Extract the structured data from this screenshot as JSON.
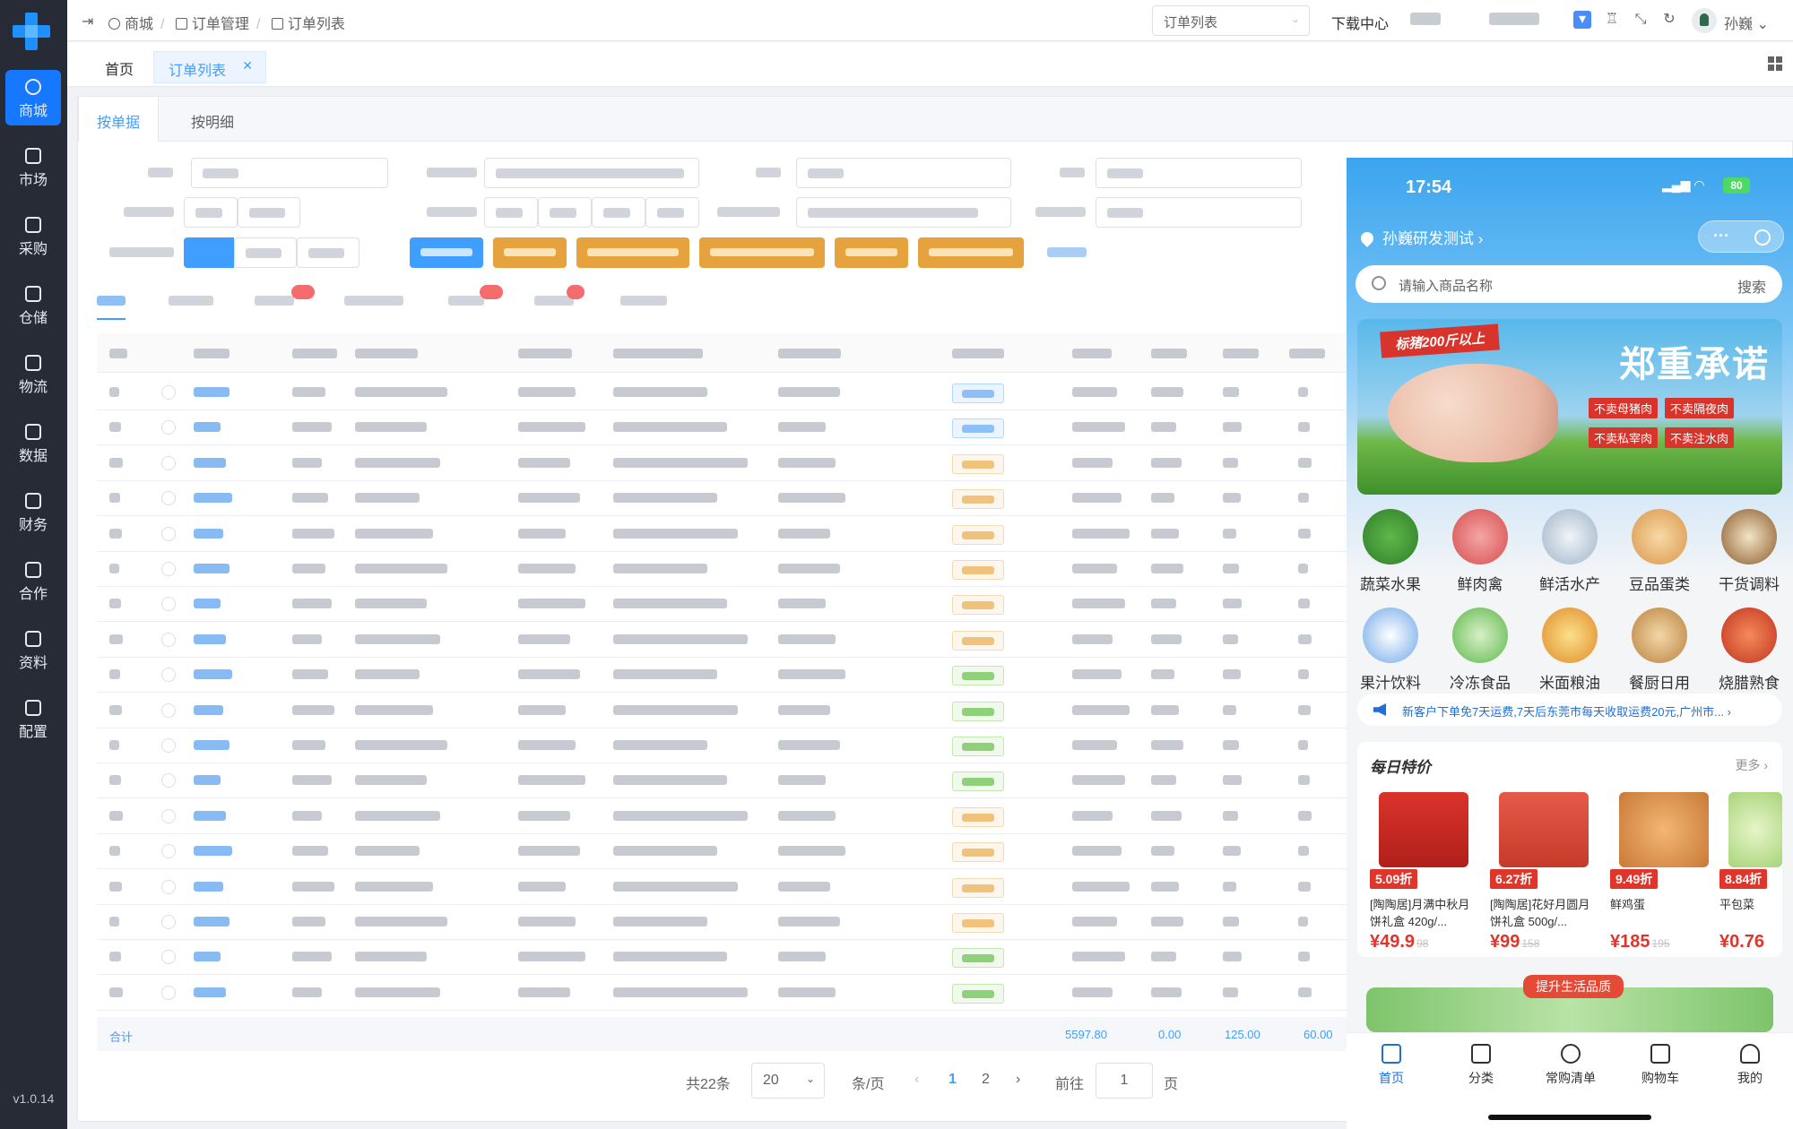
{
  "sidebar": {
    "items": [
      {
        "label": "商城",
        "icon": "shop-icon",
        "active": true
      },
      {
        "label": "市场",
        "icon": "market-icon"
      },
      {
        "label": "采购",
        "icon": "purchase-icon"
      },
      {
        "label": "仓储",
        "icon": "warehouse-icon"
      },
      {
        "label": "物流",
        "icon": "truck-icon"
      },
      {
        "label": "数据",
        "icon": "database-icon"
      },
      {
        "label": "财务",
        "icon": "finance-icon"
      },
      {
        "label": "合作",
        "icon": "cooperation-icon"
      },
      {
        "label": "资料",
        "icon": "info-icon"
      },
      {
        "label": "配置",
        "icon": "user-config-icon"
      }
    ],
    "version": "v1.0.14"
  },
  "topbar": {
    "breadcrumb": [
      "商城",
      "订单管理",
      "订单列表"
    ],
    "page_select": "订单列表",
    "download": "下载中心",
    "username": "孙巍"
  },
  "tabs": {
    "home": "首页",
    "active": "订单列表"
  },
  "subtabs": [
    "按单据",
    "按明细"
  ],
  "table": {
    "total_label": "合计",
    "totals": [
      "5597.80",
      "0.00",
      "125.00",
      "60.00"
    ],
    "row_count": 18
  },
  "pagination": {
    "total": "共22条",
    "page_size": "20",
    "per_page": "条/页",
    "pages": [
      "1",
      "2"
    ],
    "current": "1",
    "goto_label": "前往",
    "goto_value": "1",
    "page_unit": "页"
  },
  "phone": {
    "time": "17:54",
    "battery": "80",
    "location": "孙巍研发测试",
    "search_placeholder": "请输入商品名称",
    "search_button": "搜索",
    "banner": {
      "ribbon": "标猪200斤以上",
      "title": "郑重承诺",
      "tags": [
        "不卖母猪肉",
        "不卖隔夜肉",
        "不卖私宰肉",
        "不卖注水肉"
      ]
    },
    "categories": [
      "蔬菜水果",
      "鲜肉禽",
      "鲜活水产",
      "豆品蛋类",
      "干货调料",
      "果汁饮料",
      "冷冻食品",
      "米面粮油",
      "餐厨日用",
      "烧腊熟食"
    ],
    "notice": "新客户下单免7天运费,7天后东莞市每天收取运费20元,广州市...",
    "deals": {
      "title": "每日特价",
      "more": "更多",
      "products": [
        {
          "discount": "5.09折",
          "name": "[陶陶居]月满中秋月饼礼盒 420g/...",
          "price": "¥49.9",
          "orig": "98"
        },
        {
          "discount": "6.27折",
          "name": "[陶陶居]花好月圆月饼礼盒 500g/...",
          "price": "¥99",
          "orig": "158"
        },
        {
          "discount": "9.49折",
          "name": "鲜鸡蛋",
          "price": "¥185",
          "orig": "195"
        },
        {
          "discount": "8.84折",
          "name": "平包菜",
          "price": "¥0.76",
          "orig": ""
        }
      ]
    },
    "promo": "提升生活品质",
    "tabbar": [
      "首页",
      "分类",
      "常购清单",
      "购物车",
      "我的"
    ]
  }
}
